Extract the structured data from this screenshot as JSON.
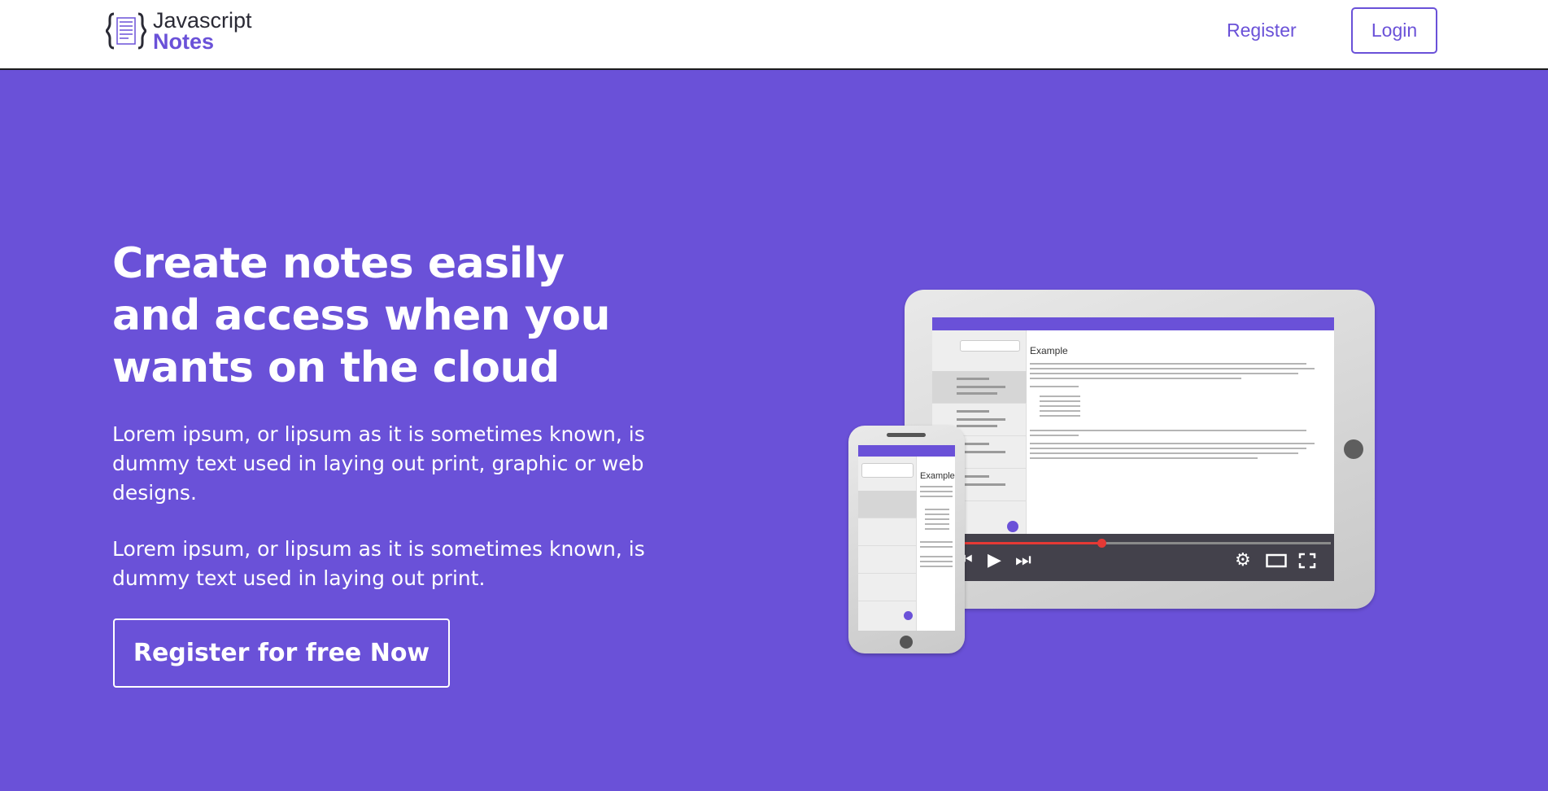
{
  "header": {
    "logo": {
      "line1": "Javascript",
      "line2": "Notes",
      "icon": "notes-braces-icon"
    },
    "nav": {
      "register_label": "Register",
      "login_label": "Login"
    }
  },
  "hero": {
    "title": "Create notes easily and access when you wants on the cloud",
    "paragraph1": "Lorem ipsum, or lipsum as it is sometimes known, is dummy text used in laying out print, graphic or web designs.",
    "paragraph2": "Lorem ipsum, or lipsum as it is sometimes known, is dummy text used in laying out print.",
    "cta_label": "Register for free Now"
  },
  "illustration": {
    "note_title": "Example",
    "video_icons": [
      "prev-icon",
      "play-icon",
      "next-icon",
      "settings-icon",
      "theater-icon",
      "fullscreen-icon"
    ]
  },
  "colors": {
    "brand": "#6a51d8",
    "header_bg": "#ffffff",
    "text_light": "#ffffff"
  }
}
